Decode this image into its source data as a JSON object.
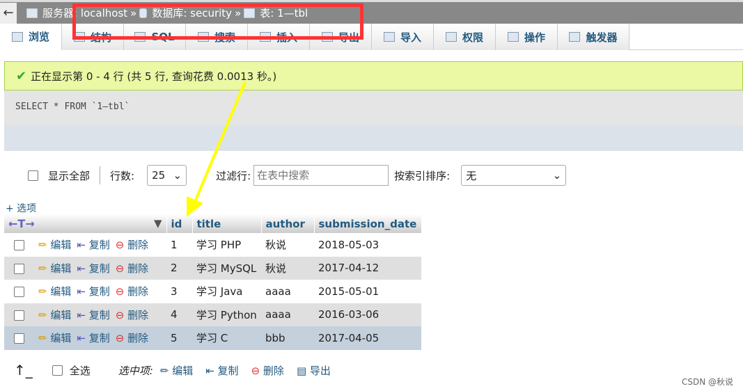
{
  "breadcrumb": {
    "back": "←",
    "server": "服务器: localhost",
    "sep": "»",
    "database": "数据库: security",
    "table": "表: 1—tbl"
  },
  "tabs": [
    {
      "label": "浏览",
      "icon": "table-icon"
    },
    {
      "label": "结构",
      "icon": "structure-icon"
    },
    {
      "label": "SQL",
      "icon": "sql-icon"
    },
    {
      "label": "搜索",
      "icon": "search-icon"
    },
    {
      "label": "插入",
      "icon": "insert-icon"
    },
    {
      "label": "导出",
      "icon": "export-icon"
    },
    {
      "label": "导入",
      "icon": "import-icon"
    },
    {
      "label": "权限",
      "icon": "privileges-icon"
    },
    {
      "label": "操作",
      "icon": "wrench-icon"
    },
    {
      "label": "触发器",
      "icon": "triggers-icon"
    }
  ],
  "success_message": "正在显示第 0 - 4 行 (共 5 行, 查询花费 0.0013 秒。)",
  "query": "SELECT * FROM `1—tbl`",
  "nav": {
    "show_all": "显示全部",
    "rows_label": "行数:",
    "rows_value": "25",
    "filter_label": "过滤行:",
    "filter_placeholder": "在表中搜索",
    "sort_label": "按索引排序:",
    "sort_value": "无"
  },
  "options_link": "+ 选项",
  "columns": [
    "id",
    "title",
    "author",
    "submission_date"
  ],
  "actions": {
    "edit": "编辑",
    "copy": "复制",
    "delete": "删除"
  },
  "rows": [
    {
      "id": "1",
      "title": "学习 PHP",
      "author": "秋说",
      "submission_date": "2018-05-03"
    },
    {
      "id": "2",
      "title": "学习 MySQL",
      "author": "秋说",
      "submission_date": "2017-04-12"
    },
    {
      "id": "3",
      "title": "学习 Java",
      "author": "aaaa",
      "submission_date": "2015-05-01"
    },
    {
      "id": "4",
      "title": "学习 Python",
      "author": "aaaa",
      "submission_date": "2016-03-06"
    },
    {
      "id": "5",
      "title": "学习 C",
      "author": "bbb",
      "submission_date": "2017-04-05"
    }
  ],
  "bottom": {
    "check_all": "全选",
    "with_selected": "选中项:",
    "edit": "编辑",
    "copy": "复制",
    "delete": "删除",
    "export": "导出"
  },
  "watermark": "CSDN @秋说",
  "colors": {
    "link": "#235a81",
    "success_bg": "#ebf8a4",
    "annotation_red": "#ff3333",
    "annotation_arrow": "#ffff00"
  }
}
